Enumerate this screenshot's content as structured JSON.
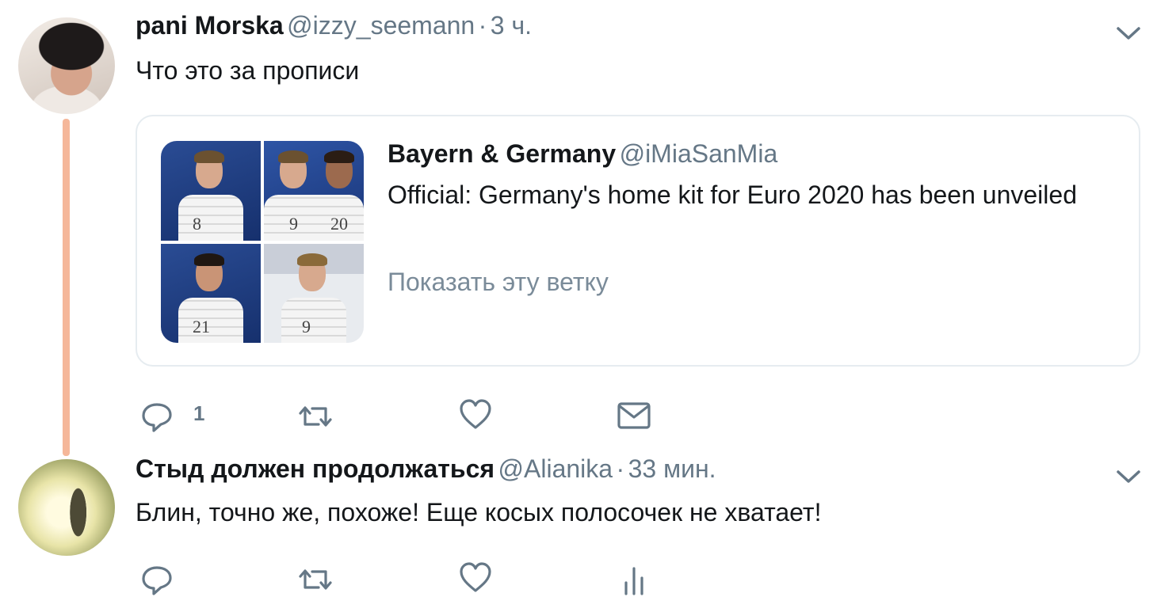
{
  "tweet1": {
    "name": "pani Morska",
    "handle": "@izzy_seemann",
    "sep": "·",
    "time": "3 ч.",
    "text": "Что это за прописи",
    "reply_count": "1"
  },
  "quoted": {
    "name": "Bayern & Germany",
    "handle": "@iMiaSanMia",
    "text": "Official: Germany's home kit for Euro 2020 has been unveiled",
    "show_thread": "Показать эту ветку",
    "jersey_numbers": [
      "8",
      "9",
      "20",
      "21",
      "9"
    ]
  },
  "tweet2": {
    "name": "Стыд должен продолжаться",
    "handle": "@Alianika",
    "sep": "·",
    "time": "33 мин.",
    "text": "Блин, точно же, похоже! Еще косых полосочек не хватает!"
  },
  "colors": {
    "thread_line": "#f5b79a",
    "secondary_text": "#657786",
    "icon": "#657786"
  },
  "icons": [
    "chevron-down-icon",
    "reply-icon",
    "retweet-icon",
    "like-icon",
    "dm-icon",
    "analytics-icon"
  ]
}
